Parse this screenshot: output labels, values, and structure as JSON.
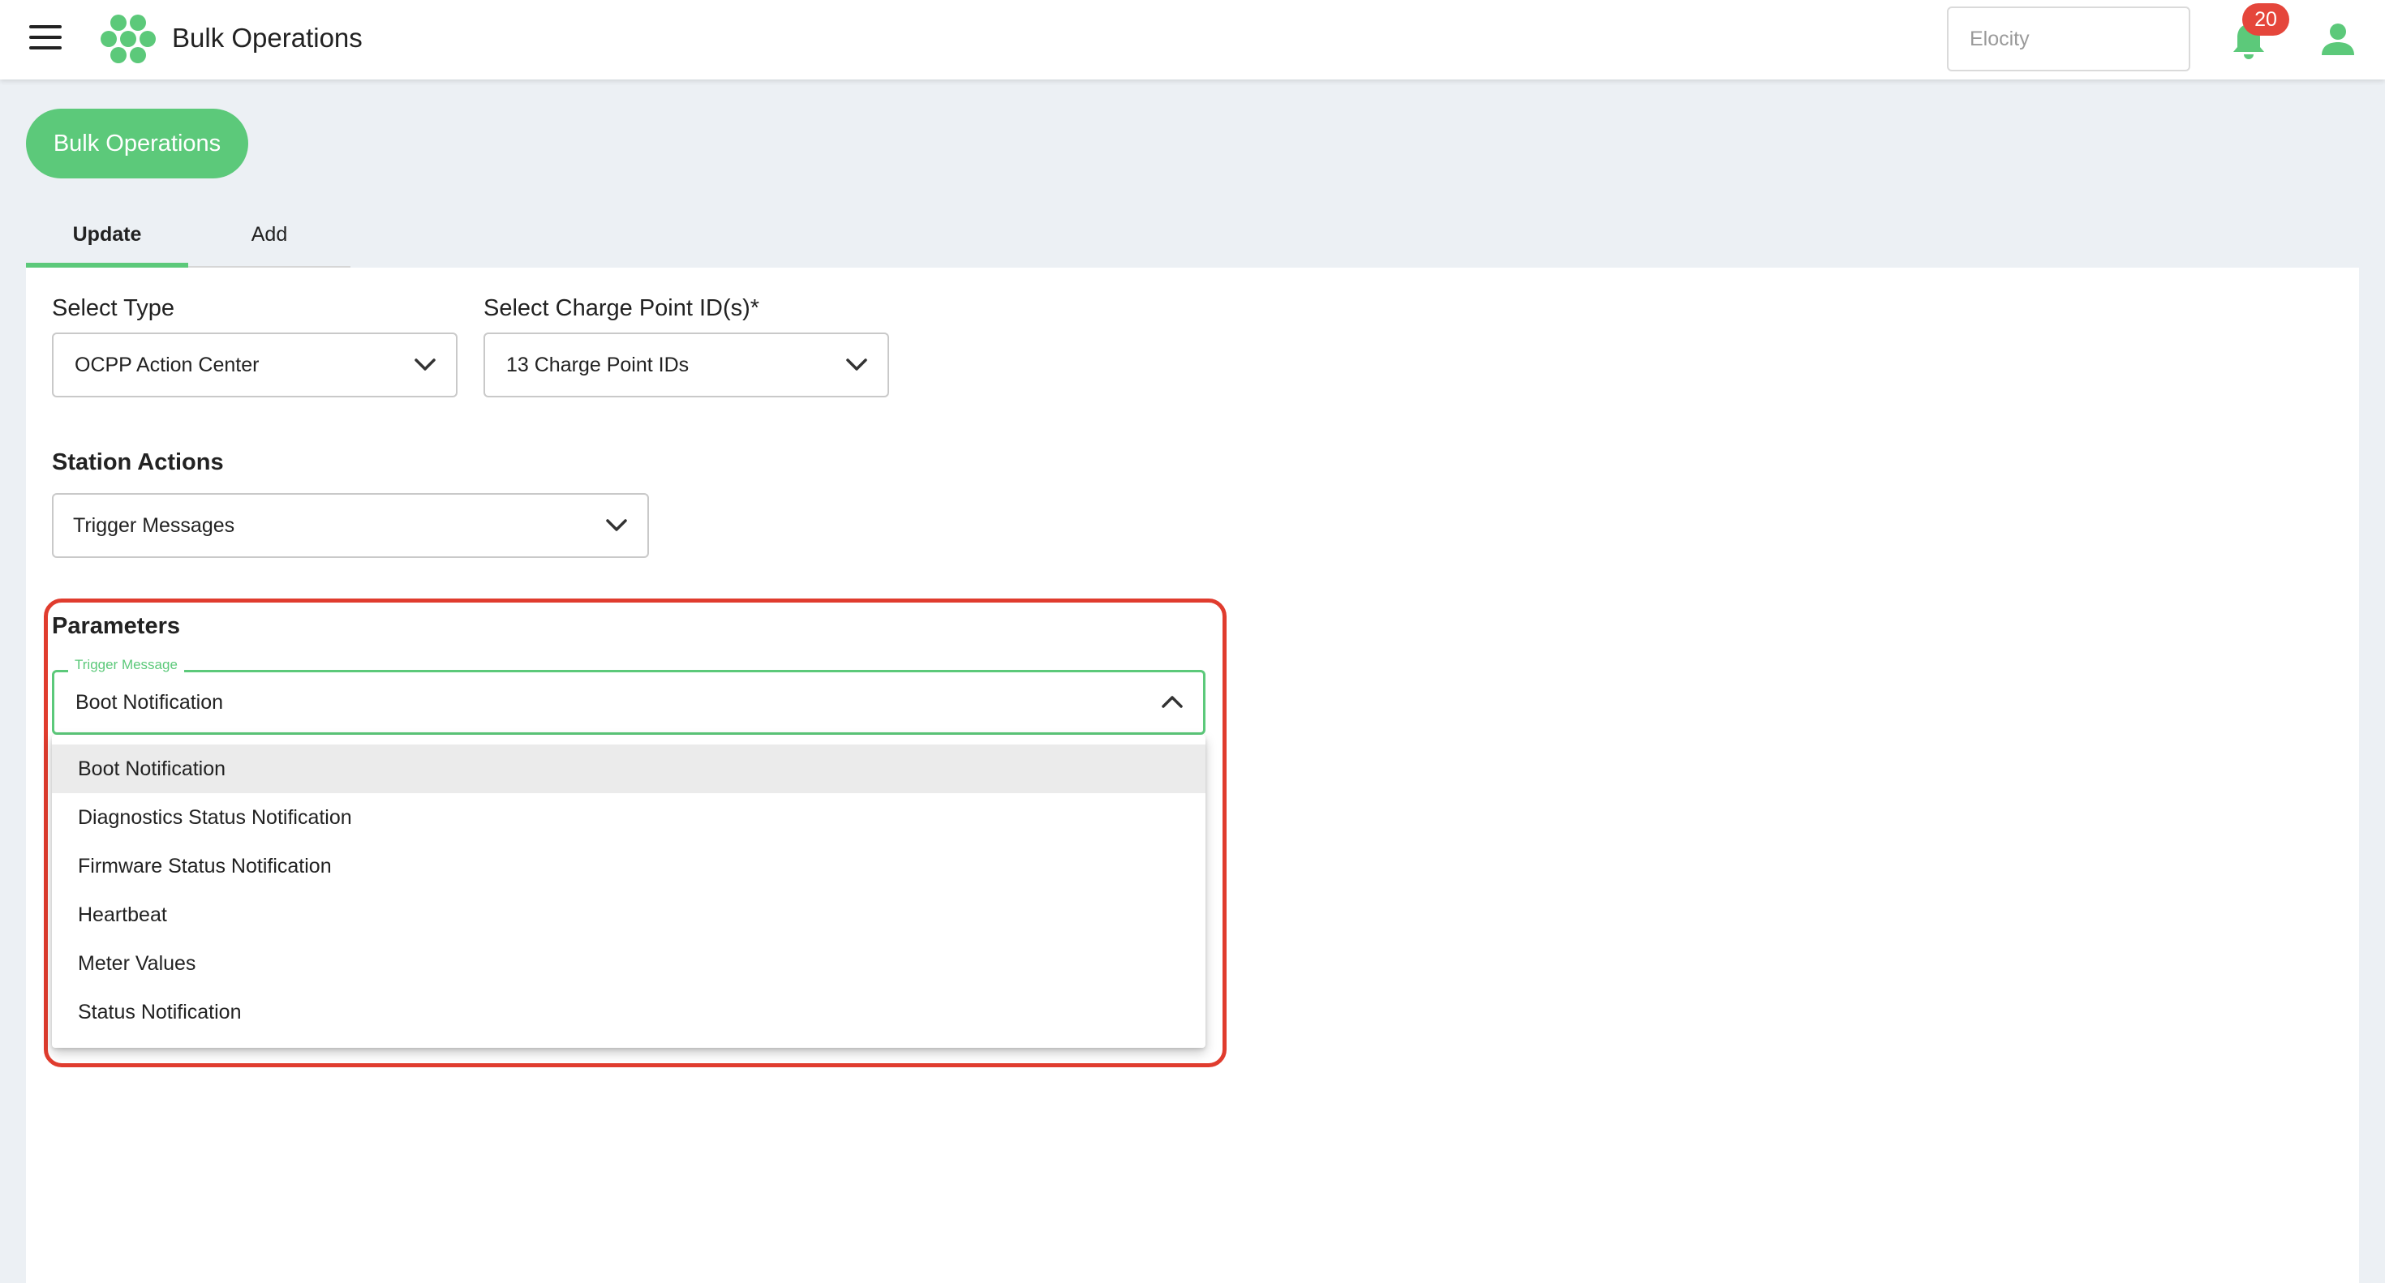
{
  "header": {
    "title": "Bulk Operations",
    "tenant_placeholder": "Elocity",
    "notification_count": "20",
    "brand_color": "#5cc97a"
  },
  "page": {
    "page_button": "Bulk Operations",
    "tabs": [
      {
        "label": "Update",
        "active": true
      },
      {
        "label": "Add",
        "active": false
      }
    ]
  },
  "form": {
    "select_type": {
      "label": "Select Type",
      "value": "OCPP Action Center"
    },
    "charge_points": {
      "label": "Select Charge Point ID(s)*",
      "value": "13 Charge Point IDs"
    },
    "station_actions": {
      "label": "Station Actions",
      "value": "Trigger Messages"
    },
    "parameters": {
      "label": "Parameters",
      "trigger_message": {
        "legend": "Trigger Message",
        "value": "Boot Notification",
        "options": [
          "Boot Notification",
          "Diagnostics Status Notification",
          "Firmware Status Notification",
          "Heartbeat",
          "Meter Values",
          "Status Notification"
        ]
      }
    }
  },
  "icons": {
    "menu": "menu-icon",
    "logo": "hexagon-logo-icon",
    "bell": "bell-icon",
    "user": "user-icon",
    "chevron_down": "chevron-down-icon",
    "chevron_up": "chevron-up-icon"
  }
}
